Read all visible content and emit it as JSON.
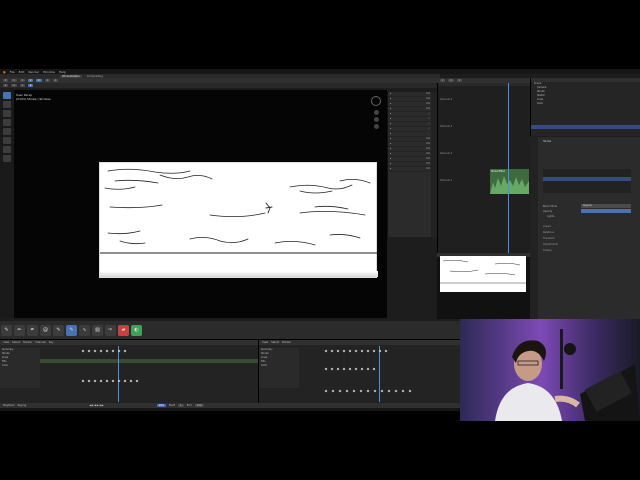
{
  "menubar": {
    "items": [
      "File",
      "Edit",
      "Render",
      "Window",
      "Help"
    ],
    "title": ""
  },
  "workspaces": {
    "tabs": [
      "2D Animation",
      "Compositing"
    ],
    "active": "2D Animation"
  },
  "viewport": {
    "view_name": "User Persp",
    "subtitle": "(0103) Stroke | Strokes"
  },
  "sequencer": {
    "channel_labels": [
      "Channel 4",
      "Channel 3",
      "Channel 2",
      "Channel 1"
    ],
    "strip_label": "Stroke Effect"
  },
  "properties": {
    "layer_label": "Stroke",
    "blend_label": "Blend Mode",
    "blend_value": "Regular",
    "opacity_label": "Opacity",
    "lights_label": "Lights",
    "sections": [
      "Layers",
      "Relations",
      "Transform",
      "Adjustments",
      "Display"
    ]
  },
  "outliner": {
    "items": [
      "Scene",
      "Camera",
      "Stroke",
      "Sketch",
      "Lines",
      "Color"
    ],
    "selected": "Stroke"
  },
  "dopesheet": {
    "channels": [
      "Summary",
      "Stroke",
      "Lines",
      "Fills",
      "Color"
    ],
    "header_items": [
      "View",
      "Select",
      "Marker",
      "Channel",
      "Key"
    ]
  },
  "timeline": {
    "playback": "Playback",
    "keying": "Keying",
    "current_frame": "103",
    "start_label": "Start",
    "start": "1",
    "end_label": "End",
    "end": "250"
  },
  "colors": {
    "accent": "#4772b3",
    "panel": "#2b2b2b",
    "bg": "#1d1d1d",
    "strip": "#3d6b3d"
  }
}
